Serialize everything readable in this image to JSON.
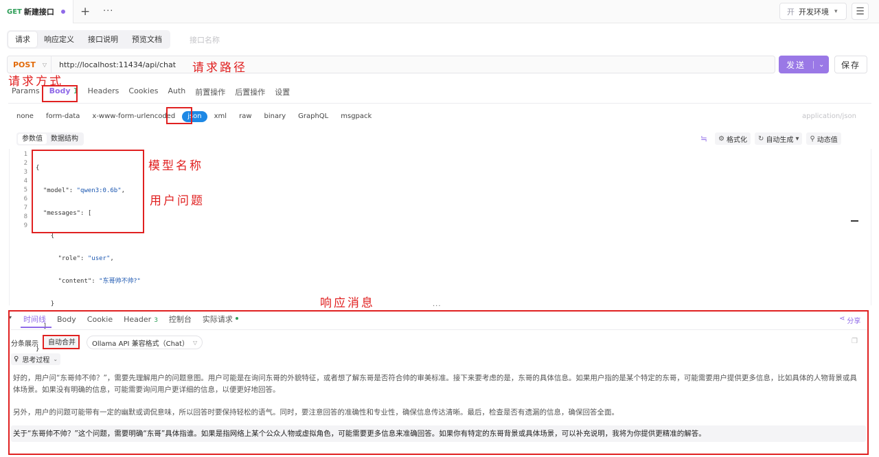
{
  "top_tab": {
    "method": "GET",
    "title": "新建接口"
  },
  "env": {
    "icon": "开",
    "label": "开发环境"
  },
  "sub_tabs": [
    "请求",
    "响应定义",
    "接口说明",
    "预览文档"
  ],
  "sub_tab_name_placeholder": "接口名称",
  "request": {
    "method": "POST",
    "url": "http://localhost:11434/api/chat",
    "send_label": "发送",
    "save_label": "保存"
  },
  "req_tabs": {
    "params": "Params",
    "body": "Body",
    "body_count": "1",
    "headers": "Headers",
    "cookies": "Cookies",
    "auth": "Auth",
    "pre": "前置操作",
    "post": "后置操作",
    "settings": "设置"
  },
  "body_types": [
    "none",
    "form-data",
    "x-www-form-urlencoded",
    "json",
    "xml",
    "raw",
    "binary",
    "GraphQL",
    "msgpack"
  ],
  "content_type": "application/json",
  "editor_tabs": [
    "参数值",
    "数据结构"
  ],
  "editor_tools": {
    "format": "格式化",
    "auto": "自动生成",
    "dynamic": "动态值"
  },
  "code_lines": {
    "l1": "{",
    "l2_key": "\"model\"",
    "l2_val": "\"qwen3:0.6b\"",
    "l3_key": "\"messages\"",
    "l3_rest": ": [",
    "l4": "{",
    "l5_key": "\"role\"",
    "l5_val": "\"user\"",
    "l6_key": "\"content\"",
    "l6_val_open": "\"",
    "l6_val": "东哥帅不帅?",
    "l6_val_close": "\"",
    "l7": "}",
    "l8": "]",
    "l9": "}"
  },
  "line_numbers": [
    "1",
    "2",
    "3",
    "4",
    "5",
    "6",
    "7",
    "8",
    "9"
  ],
  "annotations": {
    "method": "请求方式",
    "path": "请求路径",
    "model": "模型名称",
    "question": "用户问题",
    "response": "响应消息"
  },
  "response": {
    "tabs": {
      "timeline": "时间线",
      "body": "Body",
      "cookie": "Cookie",
      "header": "Header",
      "header_count": "3",
      "console": "控制台",
      "actual": "实际请求"
    },
    "share": "分享",
    "split_label": "分条展示",
    "merge_label": "自动合并",
    "format": "Ollama API 兼容格式（Chat）",
    "think_label": "思考过程",
    "para1": "好的，用户问“东哥帅不帅？”，需要先理解用户的问题意图。用户可能是在询问东哥的外貌特征，或者想了解东哥是否符合帅的审美标准。接下来要考虑的是，东哥的具体信息。如果用户指的是某个特定的东哥，可能需要用户提供更多信息，比如具体的人物背景或具体场景。如果没有明确的信息，可能需要询问用户更详细的信息，以便更好地回答。",
    "para2": "另外，用户的问题可能带有一定的幽默或调侃意味，所以回答时要保持轻松的语气。同时，要注意回答的准确性和专业性，确保信息传达清晰。最后，检查是否有遗漏的信息，确保回答全面。",
    "answer": "关于“东哥帅不帅？”这个问题，需要明确“东哥”具体指谁。如果是指网络上某个公众人物或虚拟角色，可能需要更多信息来准确回答。如果你有特定的东哥背景或具体场景，可以补充说明，我将为你提供更精准的解答。"
  },
  "icons": [
    "plus-icon",
    "more-icon",
    "menu-icon",
    "caret-down-icon",
    "wrap-icon",
    "format-icon",
    "refresh-icon",
    "magic-icon",
    "share-icon",
    "copy-icon",
    "bulb-icon"
  ],
  "colors": {
    "accent": "#8f6ae8",
    "post": "#e26b0a",
    "get": "#2e9e58",
    "annotation": "#e02020",
    "json_active": "#1e88e5"
  }
}
